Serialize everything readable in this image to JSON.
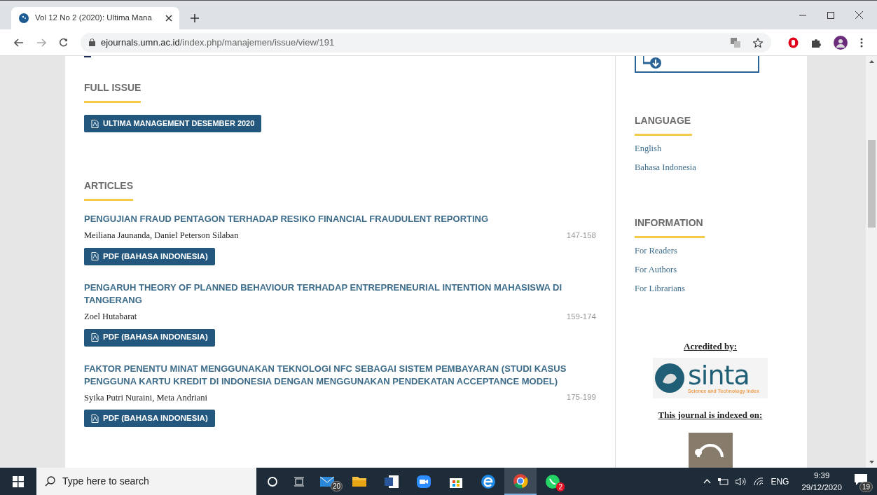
{
  "browser": {
    "tab_title": "Vol 12 No 2 (2020): Ultima Mana",
    "url_host": "ejournals.umn.ac.id",
    "url_path": "/index.php/manajemen/issue/view/191"
  },
  "full_issue": {
    "heading": "FULL ISSUE",
    "button": "ULTIMA MANAGEMENT DESEMBER 2020"
  },
  "articles": {
    "heading": "ARTICLES",
    "items": [
      {
        "title": "PENGUJIAN FRAUD PENTAGON TERHADAP RESIKO FINANCIAL FRAUDULENT REPORTING",
        "authors": "Meiliana Jaunanda, Daniel Peterson Silaban",
        "pages": "147-158",
        "button": "PDF (BAHASA INDONESIA)"
      },
      {
        "title": "PENGARUH THEORY OF PLANNED BEHAVIOUR TERHADAP ENTREPRENEURIAL INTENTION MAHASISWA DI TANGERANG",
        "authors": "Zoel Hutabarat",
        "pages": "159-174",
        "button": "PDF (BAHASA INDONESIA)"
      },
      {
        "title": "FAKTOR PENENTU MINAT MENGGUNAKAN TEKNOLOGI NFC SEBAGAI SISTEM PEMBAYARAN (STUDI KASUS PENGGUNA KARTU KREDIT DI INDONESIA DENGAN MENGGUNAKAN PENDEKATAN ACCEPTANCE MODEL)",
        "authors": "Syika Putri Nuraini, Meta Andriani",
        "pages": "175-199",
        "button": "PDF (BAHASA INDONESIA)"
      }
    ]
  },
  "sidebar": {
    "language": {
      "heading": "LANGUAGE",
      "links": [
        "English",
        "Bahasa Indonesia"
      ]
    },
    "information": {
      "heading": "INFORMATION",
      "links": [
        "For Readers",
        "For Authors",
        "For Librarians"
      ]
    },
    "accredited_heading": "Acredited by:",
    "sinta_logo": {
      "name": "sinta",
      "tagline": "Science and Technology Index"
    },
    "indexed_heading": "This journal is indexed on:"
  },
  "taskbar": {
    "search_placeholder": "Type here to search",
    "apps": [
      {
        "kind": "mail",
        "badge": "20",
        "selected": false
      },
      {
        "kind": "folder",
        "selected": false
      },
      {
        "kind": "word",
        "selected": false
      },
      {
        "kind": "video",
        "selected": false
      },
      {
        "kind": "store",
        "selected": false
      },
      {
        "kind": "edge",
        "selected": false
      },
      {
        "kind": "chrome",
        "selected": true
      },
      {
        "kind": "chat",
        "badge": "2",
        "selected": false
      }
    ],
    "language": "ENG",
    "time": "9:39",
    "date": "29/12/2020",
    "notifications": "19"
  }
}
